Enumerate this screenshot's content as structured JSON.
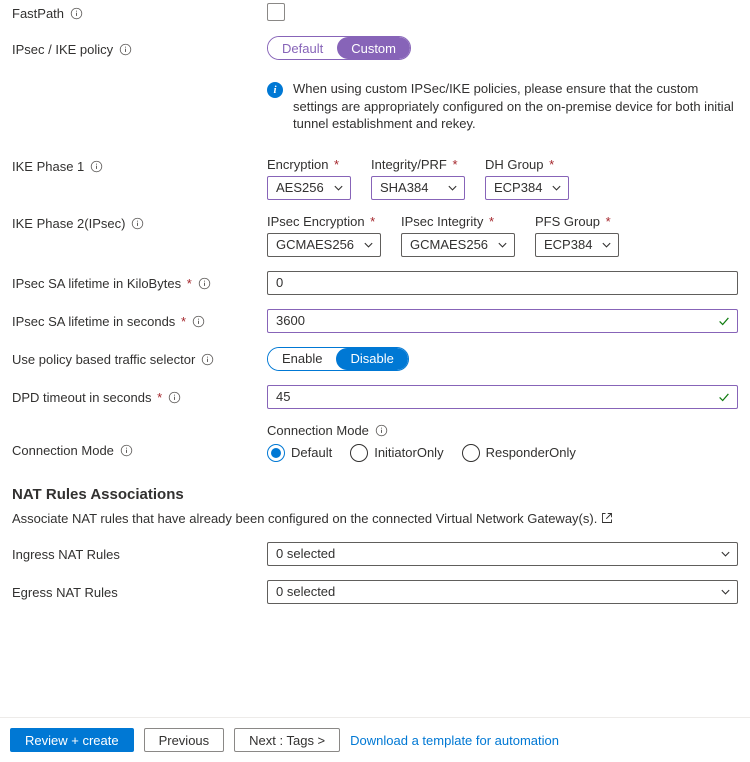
{
  "fastpath": {
    "label": "FastPath"
  },
  "ipsec_ike_policy": {
    "label": "IPsec / IKE policy",
    "option_default": "Default",
    "option_custom": "Custom",
    "selected": "Custom",
    "callout": "When using custom IPSec/IKE policies, please ensure that the custom settings are appropriately configured on the on-premise device for both initial tunnel establishment and rekey."
  },
  "ike_phase1": {
    "label": "IKE Phase 1",
    "encryption_label": "Encryption",
    "encryption_value": "AES256",
    "integrity_label": "Integrity/PRF",
    "integrity_value": "SHA384",
    "dh_label": "DH Group",
    "dh_value": "ECP384"
  },
  "ike_phase2": {
    "label": "IKE Phase 2(IPsec)",
    "enc_label": "IPsec Encryption",
    "enc_value": "GCMAES256",
    "int_label": "IPsec Integrity",
    "int_value": "GCMAES256",
    "pfs_label": "PFS Group",
    "pfs_value": "ECP384"
  },
  "sa_lifetime_kb": {
    "label": "IPsec SA lifetime in KiloBytes",
    "value": "0"
  },
  "sa_lifetime_sec": {
    "label": "IPsec SA lifetime in seconds",
    "value": "3600"
  },
  "policy_selector": {
    "label": "Use policy based traffic selector",
    "enable": "Enable",
    "disable": "Disable",
    "selected": "Disable"
  },
  "dpd_timeout": {
    "label": "DPD timeout in seconds",
    "value": "45"
  },
  "connection_mode": {
    "label": "Connection Mode",
    "field_label": "Connection Mode",
    "options": {
      "default": "Default",
      "initiator": "InitiatorOnly",
      "responder": "ResponderOnly"
    },
    "selected": "Default"
  },
  "nat_section": {
    "heading": "NAT Rules Associations",
    "subtext": "Associate NAT rules that have already been configured on the connected Virtual Network Gateway(s).",
    "ingress_label": "Ingress NAT Rules",
    "ingress_value": "0 selected",
    "egress_label": "Egress NAT Rules",
    "egress_value": "0 selected"
  },
  "footer": {
    "review": "Review + create",
    "previous": "Previous",
    "next": "Next : Tags >",
    "download": "Download a template for automation"
  }
}
